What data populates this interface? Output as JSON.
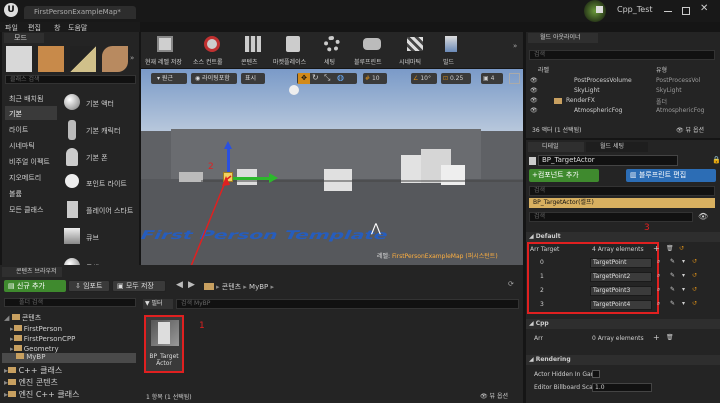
{
  "titlebar": {
    "tab": "FirstPersonExampleMap*",
    "project": "Cpp_Test"
  },
  "menu": [
    "파일",
    "편집",
    "창",
    "도움말"
  ],
  "modes": {
    "tab": "모드",
    "search_placeholder": "클래스 검색",
    "categories": [
      "최근 배치됨",
      "기본",
      "라이트",
      "시네마틱",
      "비주얼 이펙트",
      "지오메트리",
      "볼륨",
      "모든 클래스"
    ],
    "items": [
      "기본 액터",
      "기본 캐릭터",
      "기본 폰",
      "포인트 라이트",
      "플레이어 스타트",
      "큐브",
      "구체"
    ]
  },
  "toolbar": [
    "현재 레벨 저장",
    "소스 컨트롤",
    "콘텐츠",
    "마켓플레이스",
    "세팅",
    "블루프린트",
    "시네마틱",
    "빌드"
  ],
  "viewport": {
    "perspective": "원근",
    "lit": "라이팅포함",
    "show": "표시",
    "grid": "10",
    "angle": "10°",
    "scale": "0.25",
    "cam": "4",
    "level_label": "레벨:",
    "level_name": "FirstPersonExampleMap (퍼시스턴트)",
    "floor_text": "First Person Template",
    "marker2": "2"
  },
  "outliner": {
    "tab": "월드 아웃라이너",
    "search_placeholder": "검색",
    "col_label": "라벨",
    "col_type": "유형",
    "rows": [
      {
        "label": "PostProcessVolume",
        "type": "PostProcessVol"
      },
      {
        "label": "SkyLight",
        "type": "SkyLight"
      },
      {
        "label": "RenderFX",
        "type": "폴더"
      },
      {
        "label": "AtmosphericFog",
        "type": "AtmosphericFog"
      }
    ],
    "count": "36 액터 (1 선택됨)",
    "view_options": "뷰 옵션"
  },
  "details": {
    "tab": "디테일",
    "tab2": "월드 세팅",
    "name": "BP_TargetActor",
    "add_component": "+컴포넌트 추가",
    "edit_bp": "블루프린트 편집",
    "search_placeholder": "검색",
    "self_item": "BP_TargetActor(셀프)",
    "search2": "검색",
    "marker3": "3",
    "section_default": "Default",
    "arr_label": "Arr Target",
    "arr_count": "4 Array elements",
    "elements": [
      {
        "idx": "0",
        "val": "TargetPoint"
      },
      {
        "idx": "1",
        "val": "TargetPoint2"
      },
      {
        "idx": "2",
        "val": "TargetPoint3"
      },
      {
        "idx": "3",
        "val": "TargetPoint4"
      }
    ],
    "section_cpp": "Cpp",
    "arr2_label": "Arr",
    "arr2_count": "0 Array elements",
    "section_render": "Rendering",
    "render_rows": [
      {
        "label": "Actor Hidden In Gam",
        "val": ""
      },
      {
        "label": "Editor Billboard Sca",
        "val": "1.0"
      }
    ]
  },
  "content": {
    "tab": "콘텐츠 브라우저",
    "add_new": "신규 추가",
    "import": "임포트",
    "save_all": "모두 저장",
    "path": [
      "콘텐츠",
      "MyBP"
    ],
    "folder_search": "폴더 검색",
    "filter": "필터",
    "asset_search": "검색 MyBP",
    "tree": [
      "콘텐츠",
      "FirstPerson",
      "FirstPersonCPP",
      "Geometry",
      "MyBP",
      "C++ 클래스",
      "엔진 콘텐츠",
      "엔진 C++ 클래스"
    ],
    "asset_name": "BP_Target Actor",
    "marker1": "1",
    "status": "1 항목 (1 선택됨)",
    "view_options": "뷰 옵션"
  },
  "colors": {
    "accent_orange": "#d28a19",
    "red": "#e02020",
    "green_btn": "#3f8a2e",
    "blue_btn": "#2c6db5"
  }
}
